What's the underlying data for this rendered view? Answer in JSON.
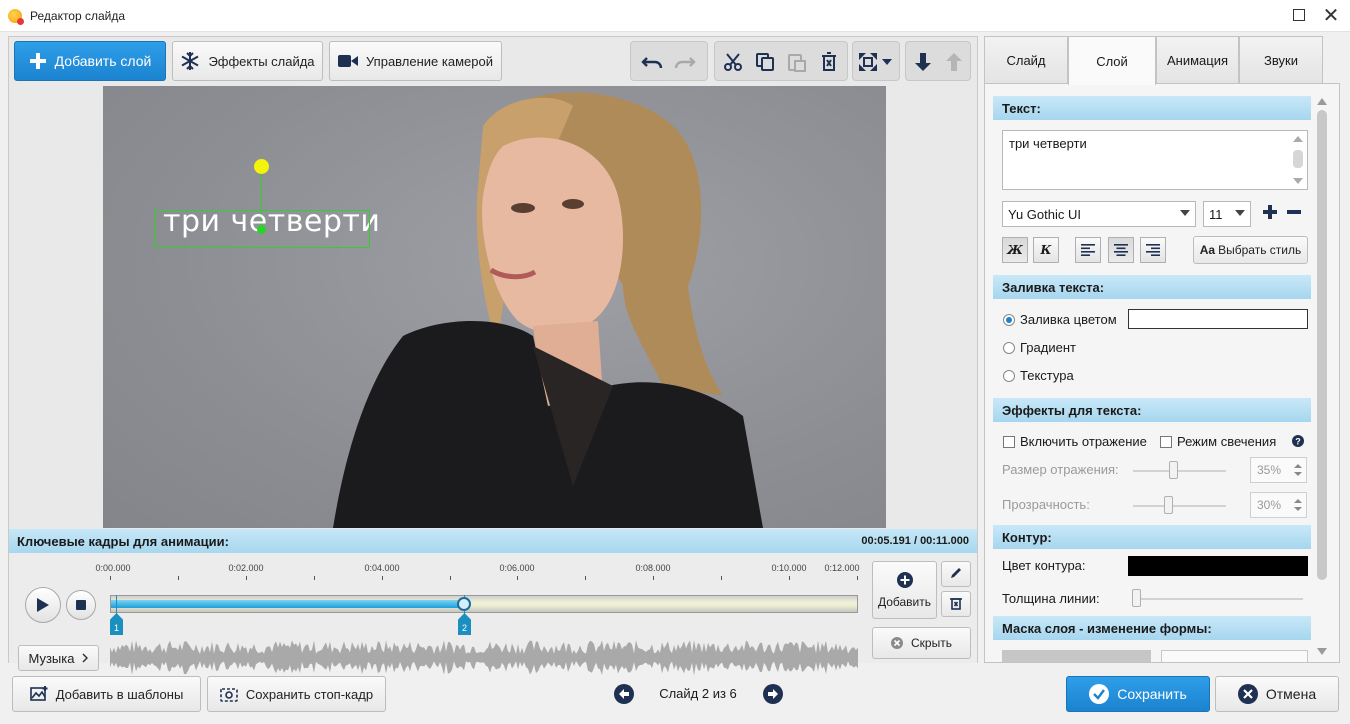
{
  "window": {
    "title": "Редактор слайда"
  },
  "toolbar": {
    "add_layer": "Добавить слой",
    "slide_effects": "Эффекты слайда",
    "camera_control": "Управление камерой"
  },
  "canvas": {
    "layer_text": "три четверти"
  },
  "keyframes": {
    "title": "Ключевые кадры для анимации:",
    "current_time": "00:05.191",
    "total_time": "00:11.000",
    "time_separator": "/",
    "ticks": [
      "0:00.000",
      "0:02.000",
      "0:04.000",
      "0:06.000",
      "0:08.000",
      "0:10.000",
      "0:12.000"
    ],
    "markers": [
      "1",
      "2"
    ],
    "progress": 0.47,
    "add_label": "Добавить",
    "hide_label": "Скрыть",
    "music_label": "Музыка"
  },
  "bottom": {
    "add_template": "Добавить в шаблоны",
    "save_still": "Сохранить стоп-кадр",
    "slide_status": "Слайд 2 из 6",
    "save": "Сохранить",
    "cancel": "Отмена"
  },
  "tabs": [
    "Слайд",
    "Слой",
    "Анимация",
    "Звуки"
  ],
  "active_tab": "Слой",
  "props": {
    "text_section": "Текст:",
    "text_value": "три четверти",
    "font": "Yu Gothic UI",
    "size": "11",
    "bold": "Ж",
    "italic": "К",
    "style_aa": "Aa",
    "style_button": "Выбрать стиль",
    "fill_section": "Заливка текста:",
    "fill_color": "Заливка цветом",
    "fill_gradient": "Градиент",
    "fill_texture": "Текстура",
    "effects_section": "Эффекты для текста:",
    "reflection": "Включить отражение",
    "glow": "Режим свечения",
    "reflection_size_label": "Размер отражения:",
    "reflection_size": "35%",
    "opacity_label": "Прозрачность:",
    "opacity": "30%",
    "outline_section": "Контур:",
    "outline_color_label": "Цвет контура:",
    "line_width_label": "Толщина линии:",
    "mask_section": "Маска слоя - изменение формы:"
  },
  "colors": {
    "accent": "#1b83d0",
    "fill_color": "#ffffff",
    "outline_color": "#000000",
    "section_bg": "#b4def3"
  }
}
